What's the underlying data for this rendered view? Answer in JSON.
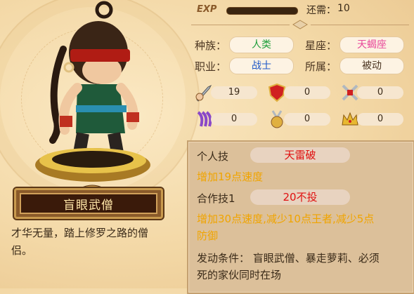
{
  "hero": {
    "name": "盲眼武僧",
    "description_lines": [
      "才华无量，踏上修罗之路的僧",
      "侣。"
    ]
  },
  "exp": {
    "label": "EXP",
    "need_label": "还需：",
    "need_value": "10"
  },
  "attributes": [
    {
      "label": "种族：",
      "value": "人类",
      "color": "#1f9e3a"
    },
    {
      "label": "星座：",
      "value": "天蝎座",
      "color": "#e8489a"
    },
    {
      "label": "职业：",
      "value": "战士",
      "color": "#1e58c8"
    },
    {
      "label": "所属：",
      "value": "被动",
      "color": "#4a3420"
    }
  ],
  "stats": [
    {
      "icon": "sword-fist-icon",
      "value": "19"
    },
    {
      "icon": "shield-icon",
      "value": "0"
    },
    {
      "icon": "crossed-swords-icon",
      "value": "0"
    },
    {
      "icon": "purple-claw-icon",
      "value": "0"
    },
    {
      "icon": "medal-icon",
      "value": "0"
    },
    {
      "icon": "crown-icon",
      "value": "0"
    }
  ],
  "skills": {
    "personal_label": "个人技",
    "personal_name": "天雷破",
    "personal_effect": "增加19点速度",
    "combo_label": "合作技1",
    "combo_name": "20不投",
    "combo_effect_lines": [
      "增加30点速度,减少10点王者,减少5点",
      "防御"
    ],
    "condition_lines": [
      "发动条件：  盲眼武僧、暴走萝莉、必须",
      "死的家伙同时在场"
    ]
  }
}
